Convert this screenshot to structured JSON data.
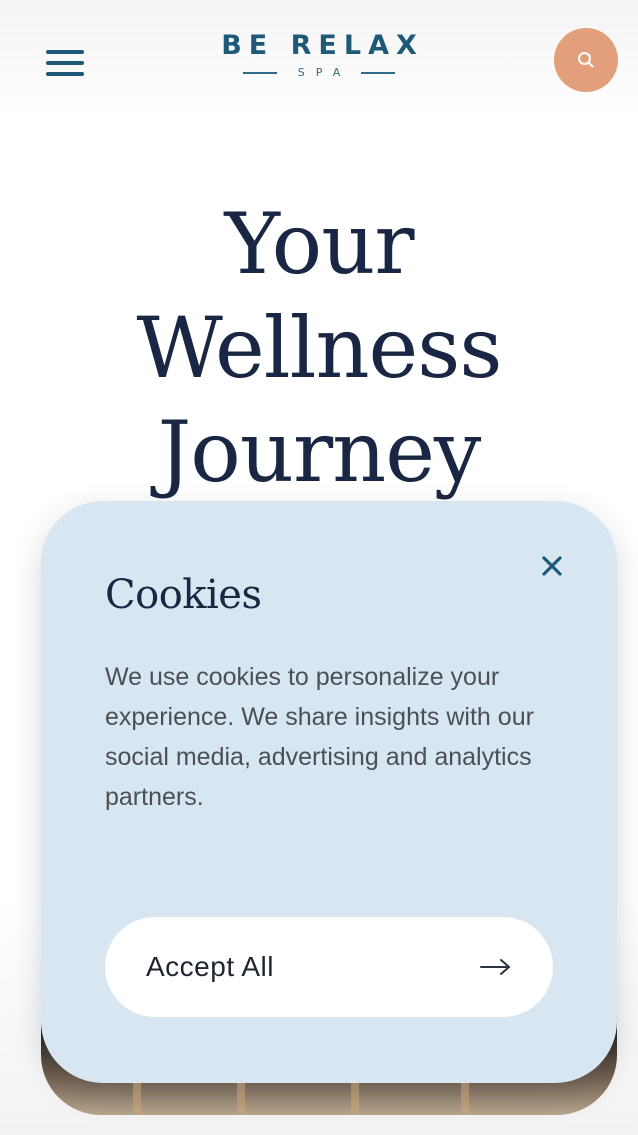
{
  "header": {
    "menu_icon": "hamburger-menu-icon",
    "logo_main": "BE RELAX",
    "logo_sub": "SPA",
    "search_icon": "search-icon",
    "search_button_color": "#e39f7c",
    "brand_color": "#1e5a78"
  },
  "hero": {
    "title_lines": [
      "Your",
      "Wellness",
      "Journey"
    ]
  },
  "cookie_banner": {
    "title": "Cookies",
    "close_icon": "close-icon",
    "body": "We use cookies to personalize your experience. We share insights with our social media, advertising and analytics partners.",
    "accept_label": "Accept All",
    "accept_icon": "arrow-right-icon",
    "background_color": "#d8e6f2"
  }
}
